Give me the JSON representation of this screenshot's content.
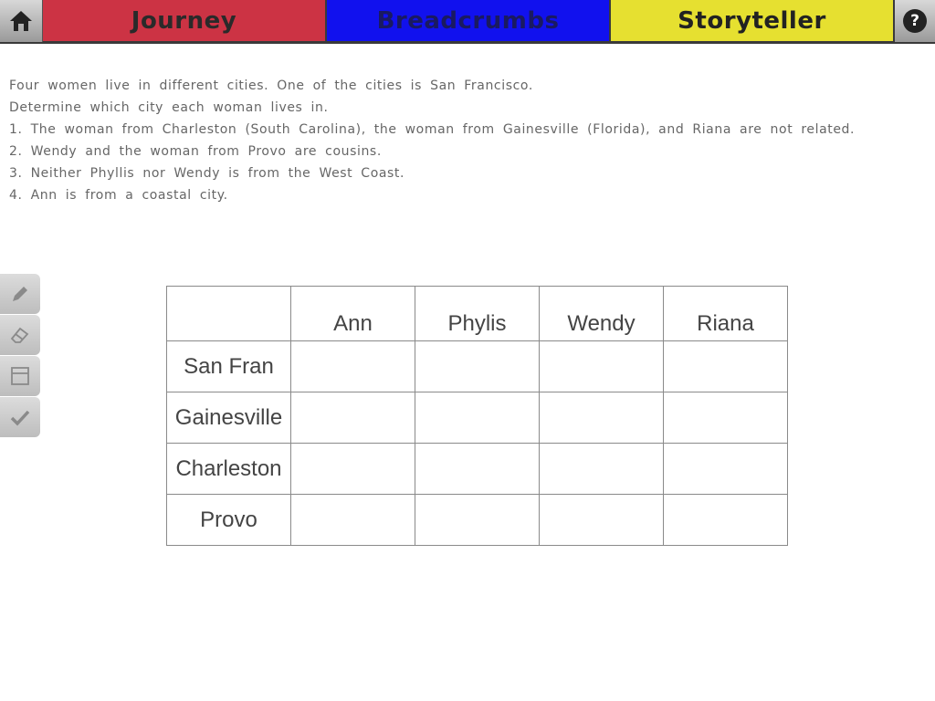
{
  "nav": {
    "tabs": [
      {
        "label": "Journey",
        "color": "#cc3344"
      },
      {
        "label": "Breadcrumbs",
        "color": "#1111ee"
      },
      {
        "label": "Storyteller",
        "color": "#e6e030"
      }
    ],
    "help_label": "?"
  },
  "puzzle": {
    "intro": "Four women live in different cities. One of the cities is San Francisco.",
    "question": "Determine which city each woman lives in.",
    "clues": [
      "1. The woman from Charleston (South Carolina), the woman from Gainesville (Florida), and Riana are not related.",
      "2. Wendy and the woman from Provo are cousins.",
      "3. Neither Phyllis nor Wendy is from the West Coast.",
      "4. Ann is from a coastal city."
    ]
  },
  "tools": [
    {
      "icon": "pencil-icon"
    },
    {
      "icon": "eraser-icon"
    },
    {
      "icon": "table-icon"
    },
    {
      "icon": "checkmark-icon"
    }
  ],
  "grid": {
    "columns": [
      "Ann",
      "Phylis",
      "Wendy",
      "Riana"
    ],
    "rows": [
      "San Fran",
      "Gainesville",
      "Charleston",
      "Provo"
    ]
  }
}
